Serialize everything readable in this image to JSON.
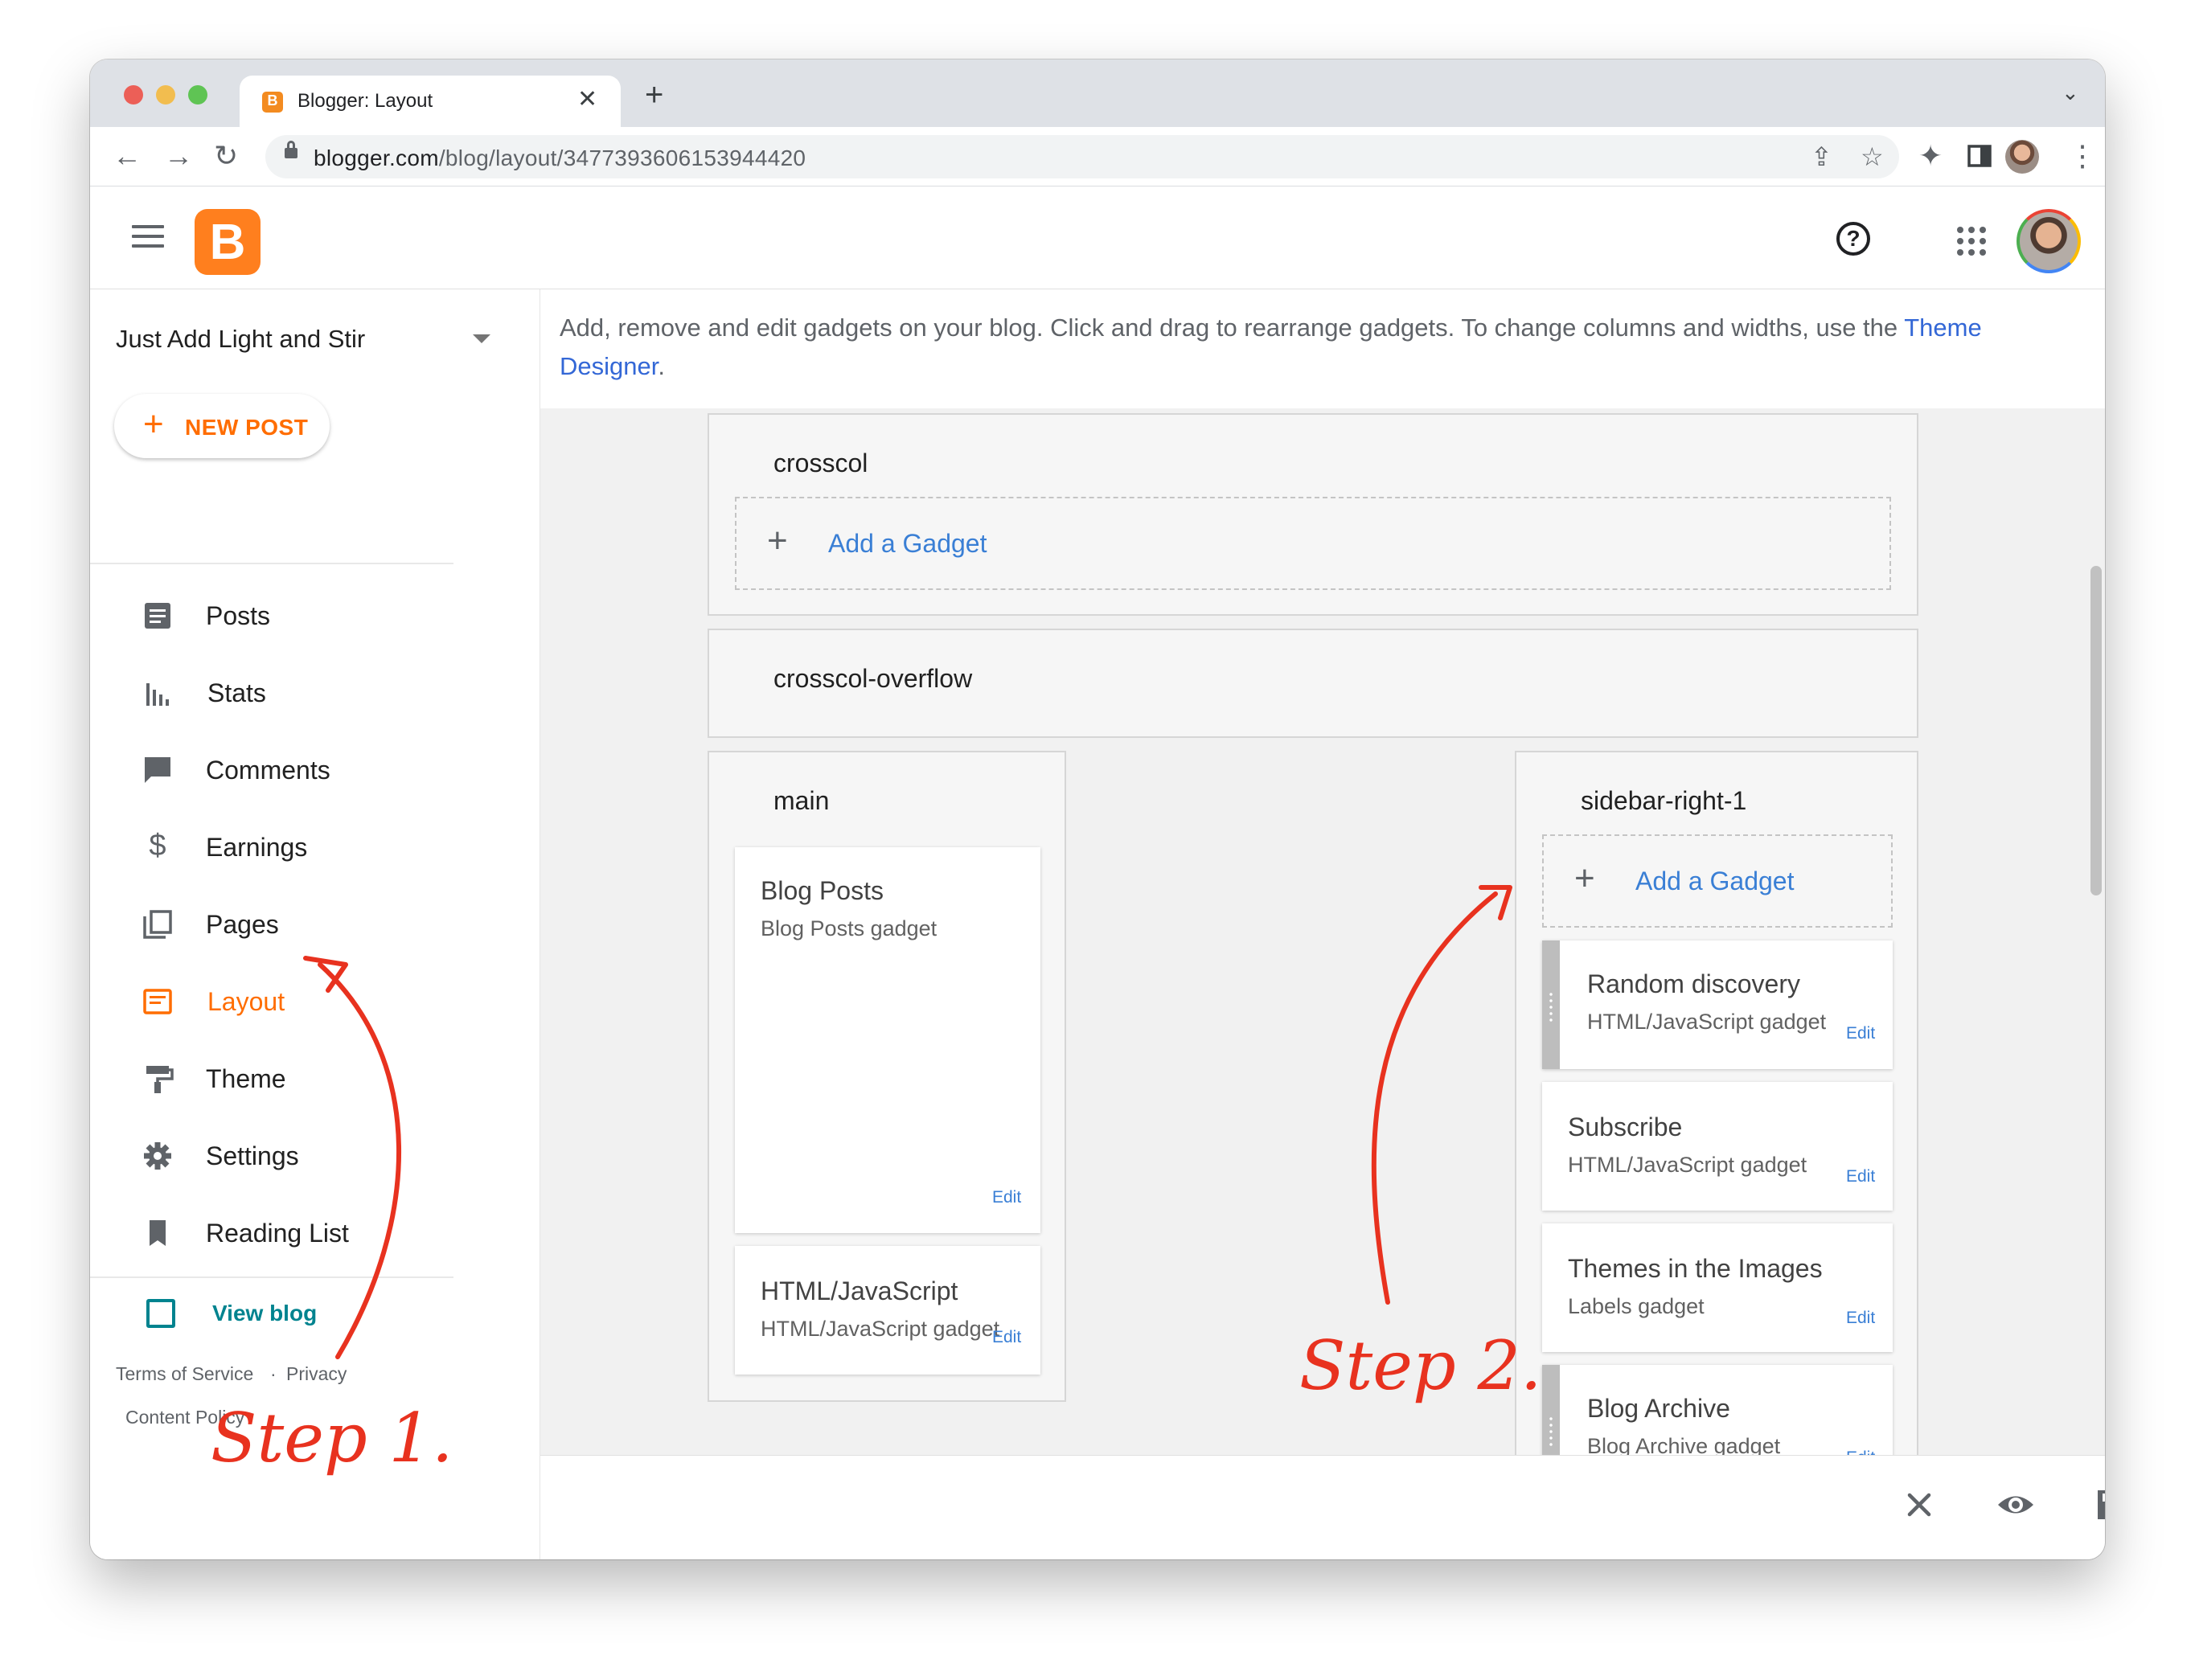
{
  "browser": {
    "tab_title": "Blogger: Layout",
    "url_domain": "blogger.com",
    "url_path": "/blog/layout/3477393606153944420"
  },
  "sidebar": {
    "blog_name": "Just Add Light and Stir",
    "new_post_label": "NEW POST",
    "items": [
      {
        "label": "Posts",
        "icon": "posts-icon"
      },
      {
        "label": "Stats",
        "icon": "stats-icon"
      },
      {
        "label": "Comments",
        "icon": "comments-icon"
      },
      {
        "label": "Earnings",
        "icon": "dollar-icon"
      },
      {
        "label": "Pages",
        "icon": "pages-icon"
      },
      {
        "label": "Layout",
        "icon": "layout-icon",
        "active": true
      },
      {
        "label": "Theme",
        "icon": "paint-roller-icon"
      },
      {
        "label": "Settings",
        "icon": "gear-icon"
      },
      {
        "label": "Reading List",
        "icon": "bookmark-icon"
      }
    ],
    "view_blog_label": "View blog",
    "footer": {
      "terms": "Terms of Service",
      "separator": "·",
      "privacy": "Privacy",
      "content_policy": "Content Policy"
    }
  },
  "content": {
    "intro_text": "Add, remove and edit gadgets on your blog. Click and drag to rearrange gadgets. To change columns and widths, use the ",
    "intro_link_1": "Theme",
    "intro_link_2": "Designer",
    "intro_period": ".",
    "add_gadget_label": "Add a Gadget",
    "sections": {
      "crosscol": "crosscol",
      "crosscol_overflow": "crosscol-overflow",
      "main": "main",
      "sidebar_right": "sidebar-right-1"
    },
    "main_gadgets": [
      {
        "title": "Blog Posts",
        "subtitle": "Blog Posts gadget",
        "edit": "Edit"
      },
      {
        "title": "HTML/JavaScript",
        "subtitle": "HTML/JavaScript gadget",
        "edit": "Edit"
      }
    ],
    "sidebar_gadgets": [
      {
        "title": "Random discovery",
        "subtitle": "HTML/JavaScript gadget",
        "edit": "Edit"
      },
      {
        "title": "Subscribe",
        "subtitle": "HTML/JavaScript gadget",
        "edit": "Edit"
      },
      {
        "title": "Themes in the Images",
        "subtitle": "Labels gadget",
        "edit": "Edit"
      },
      {
        "title": "Blog Archive",
        "subtitle": "Blog Archive gadget",
        "edit": "Edit"
      }
    ]
  },
  "annotations": {
    "step1": "Step 1.",
    "step2": "Step 2.",
    "color": "#e8321f"
  },
  "colors": {
    "brand_orange": "#ff6d00",
    "link_blue": "#3367d6"
  }
}
